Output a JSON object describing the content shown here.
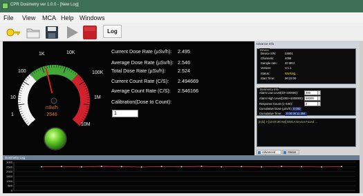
{
  "window": {
    "title": "CPR Dosimetry ver 1.0.0 - [New Log]"
  },
  "menu": {
    "items": [
      "File",
      "View",
      "MCA",
      "Help",
      "Windows"
    ]
  },
  "toolbar": {
    "log_label": "Log"
  },
  "gauge": {
    "scale_labels": [
      "1",
      "10",
      "100",
      "1K",
      "10K",
      "100K",
      "1M",
      "10M"
    ],
    "unit": "nSv/h",
    "value": "2546",
    "needle_fraction": 0.45,
    "colors": {
      "green": "#43a837",
      "red": "#d0212d",
      "white": "#f5f5f5"
    }
  },
  "readings": [
    {
      "label": "Current Dose Rate (µSv/h):",
      "value": "2.495"
    },
    {
      "label": "Average Dose Rate (µSv/h):",
      "value": "2.546"
    },
    {
      "label": "Total Dose Rate (µSv/h):",
      "value": "2.524"
    },
    {
      "label": "Current Count Rate (C/S):",
      "value": "2.494669"
    },
    {
      "label": "Average Count Rate (C/S):",
      "value": "2.546166"
    }
  ],
  "calibration": {
    "label": "Calibration(Dose to Count):",
    "value": "1"
  },
  "status_light": {
    "color": "#5acb2a"
  },
  "advance_info": {
    "panel_title": "Advance Info",
    "device": {
      "caption": "Device",
      "rows": [
        {
          "label": "Device S/N:",
          "value": "23801"
        },
        {
          "label": "Channels:",
          "value": "4096"
        },
        {
          "label": "Sample rate:",
          "value": "40 MHz"
        },
        {
          "label": "Version:",
          "value": "V.1.1"
        },
        {
          "label": "Status:",
          "value": "Working...",
          "accent": "#f2e23a"
        },
        {
          "label": "Start Time:",
          "value": "00:23:00"
        }
      ]
    },
    "dosimetry": {
      "caption": "Dosimetry Info",
      "alarm_low_label": "Alarm Low Level(10~100000):",
      "alarm_low_value": "300",
      "alarm_high_label": "Alarm High Level(1000~1000000):",
      "alarm_high_value": "90000",
      "response_label": "Response Count (1~100):",
      "response_value": "2",
      "cumulative_dose_label": "Cumulative Dose (µSv/h):",
      "cumulative_dose_value": "0.000",
      "cumulative_time_label": "Cumulative Time:",
      "cumulative_time_value": "0:00:00:11.384"
    },
    "log_line": "[Info] > [10:04:38 AM] DMCA Device Found ..."
  },
  "tabs": [
    {
      "label": "Advanced Info"
    },
    {
      "label": "Status"
    }
  ],
  "dose_log": {
    "title": "Dosimetry Log",
    "y_ticks": [
      "3000",
      "2500",
      "2000",
      "1500",
      "1000",
      "500",
      "0"
    ],
    "series_color": "#d9324a",
    "values": [
      2510,
      2540,
      2500,
      2555,
      2530,
      2490,
      2545,
      2520,
      2560,
      2505,
      2535,
      2500,
      2550,
      2525,
      2495,
      2540
    ]
  }
}
